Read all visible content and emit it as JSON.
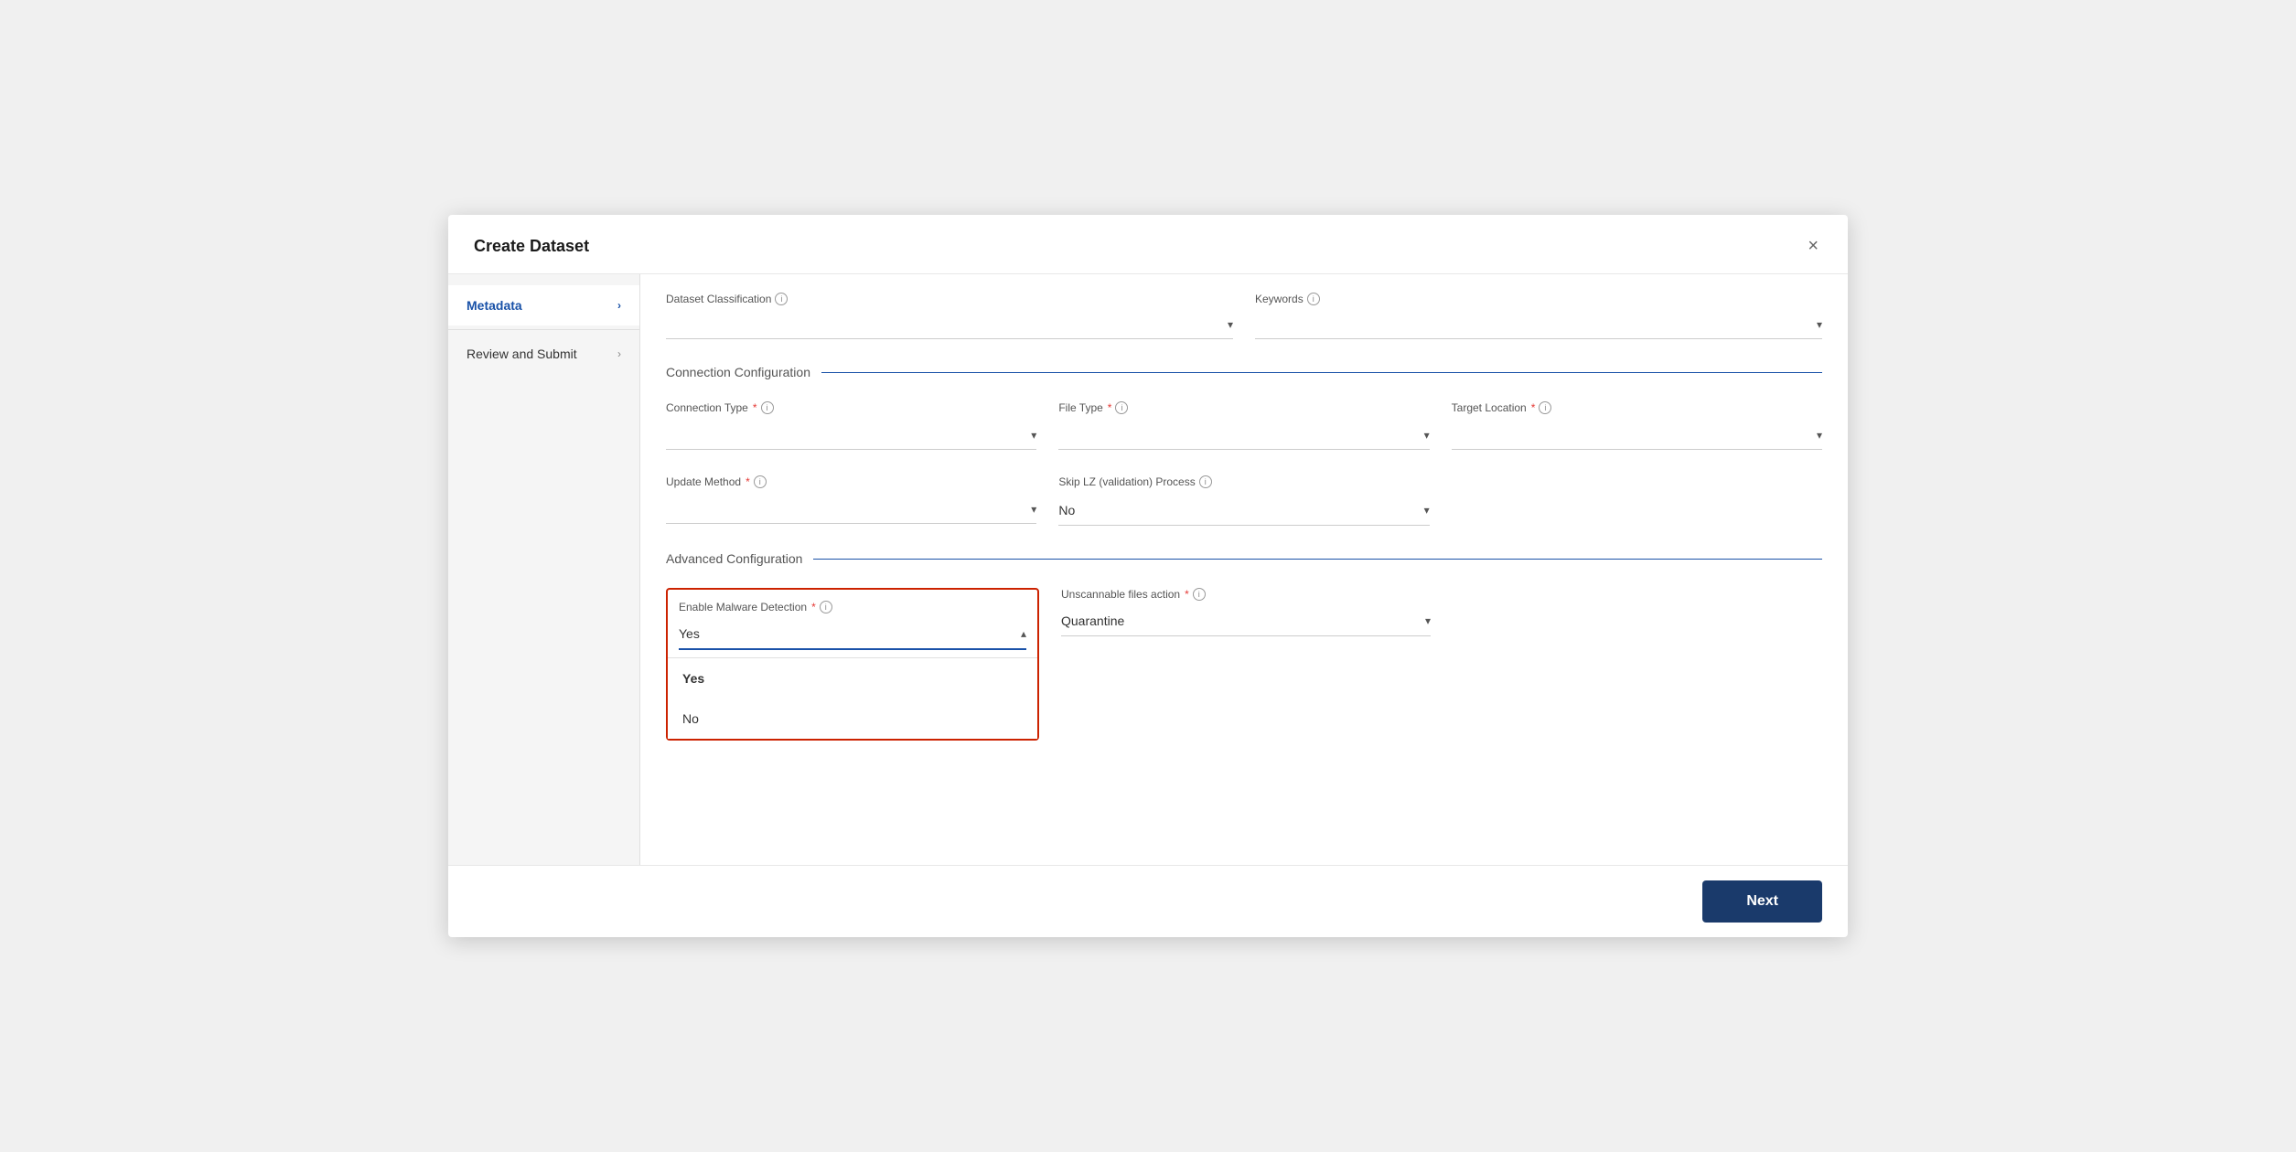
{
  "modal": {
    "title": "Create Dataset",
    "close_label": "×"
  },
  "sidebar": {
    "items": [
      {
        "id": "metadata",
        "label": "Metadata",
        "active": true
      },
      {
        "id": "review",
        "label": "Review and Submit",
        "active": false
      }
    ]
  },
  "top_fields": {
    "dataset_classification": {
      "label": "Dataset Classification",
      "placeholder": ""
    },
    "keywords": {
      "label": "Keywords",
      "placeholder": ""
    }
  },
  "connection_config": {
    "section_label": "Connection Configuration",
    "connection_type": {
      "label": "Connection Type",
      "required": true,
      "value": "",
      "placeholder": ""
    },
    "file_type": {
      "label": "File Type",
      "required": true,
      "value": "",
      "placeholder": ""
    },
    "target_location": {
      "label": "Target Location",
      "required": true,
      "value": "",
      "placeholder": ""
    },
    "update_method": {
      "label": "Update Method",
      "required": true,
      "value": "",
      "placeholder": ""
    },
    "skip_lz": {
      "label": "Skip LZ (validation) Process",
      "value": "No"
    }
  },
  "advanced_config": {
    "section_label": "Advanced Configuration",
    "enable_malware": {
      "label": "Enable Malware Detection",
      "required": true,
      "value": "Yes",
      "options": [
        "Yes",
        "No"
      ],
      "open": true
    },
    "unscannable": {
      "label": "Unscannable files action",
      "required": true,
      "value": "Quarantine"
    }
  },
  "footer": {
    "next_label": "Next"
  }
}
